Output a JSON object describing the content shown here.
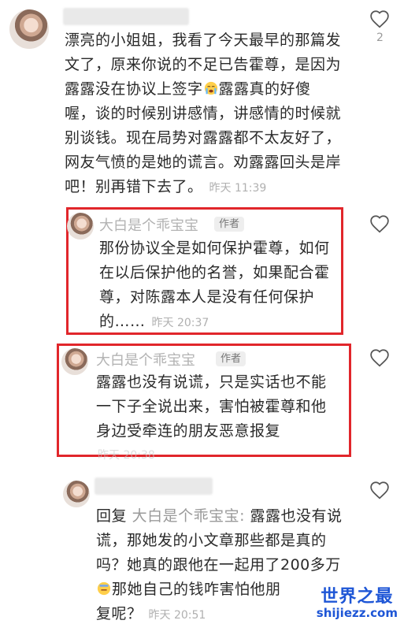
{
  "comments": [
    {
      "name": "",
      "likes": "2",
      "lines": [
        "漂亮的小姐姐，我看了今天最早的那篇发",
        "文了，原来你说的不足已告霍尊，是因为",
        "露露没在协议上签字",
        "露露真的好傻",
        "喔，谈的时候别讲感情，讲感情的时候就",
        "别谈钱。现在局势对露露都不太友好了，",
        "网友气愤的是她的谎言。劝露露回头是岸",
        "吧！别再错下去了。"
      ],
      "time": "昨天 11:39"
    },
    {
      "name": "大白是个乖宝宝",
      "badge": "作者",
      "lines": [
        "那份协议全是如何保护霍尊，如何",
        "在以后保护他的名誉，如果配合霍",
        "尊，对陈露本人是没有任何保护",
        "的……"
      ],
      "time": "昨天 20:37"
    },
    {
      "name": "大白是个乖宝宝",
      "badge": "作者",
      "lines": [
        "露露也没有说谎，只是实话也不能",
        "一下子全说出来，害怕被霍尊和他",
        "身边受牵连的朋友恶意报复"
      ],
      "time": "昨天 20:38"
    },
    {
      "name": "",
      "reply_prefix": "回复",
      "reply_to": "大白是个乖宝宝:",
      "lines": [
        "露露也没有说",
        "谎，那她发的小文章那些都是真的",
        "吗？她真的跟他在一起用了200多万",
        "那她自己的钱咋害怕他朋",
        "复呢？"
      ],
      "time": "昨天 20:51"
    }
  ],
  "watermark": {
    "title": "世界之最",
    "url": "shijiezz.com"
  },
  "colors": {
    "highlight_box": "#e1262b",
    "watermark": "#1e56d6"
  }
}
